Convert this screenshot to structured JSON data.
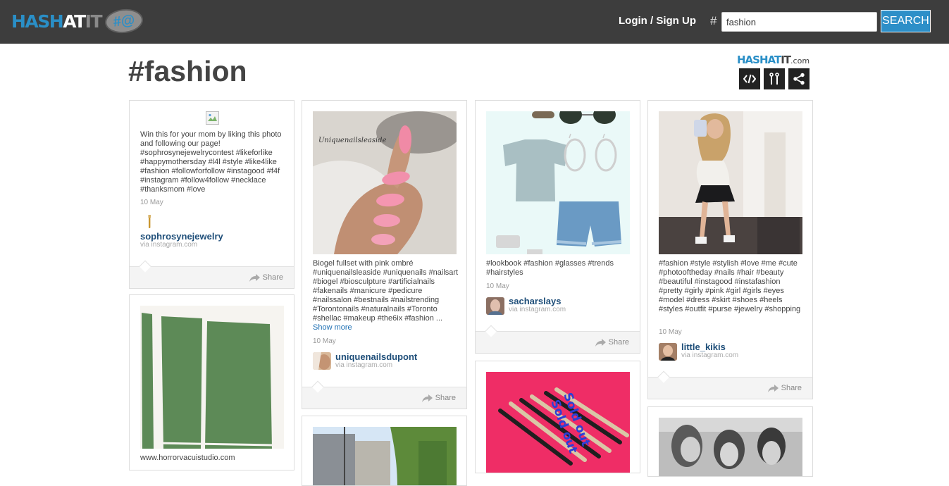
{
  "header": {
    "logo": {
      "hash": "HASH",
      "at": "AT",
      "it": "IT",
      "bubble": "#@"
    },
    "login_label": "Login / Sign Up",
    "hash_symbol": "#",
    "search_value": "fashion",
    "search_button": "SEARCH"
  },
  "page": {
    "title": "#fashion"
  },
  "brand": {
    "hash": "HASH",
    "at": "AT",
    "it": "IT",
    "dotcom": ".com"
  },
  "toolbar": [
    {
      "icon": "embed-code-icon"
    },
    {
      "icon": "customize-icon"
    },
    {
      "icon": "share-icon"
    }
  ],
  "colors": {
    "accent": "#2d8fc8",
    "topbar": "#3d3d3d",
    "username": "#1e4e79"
  },
  "share_label": "Share",
  "via_label": "via instagram.com",
  "posts": [
    {
      "caption": "Win this for your mom by liking this photo and following our page! #sophrosynejewelrycontest #likeforlike #happymothersday #l4l #style #like4like #fashion #followforfollow #instagood #f4f #instagram #follow4follow #necklace #thanksmom #love",
      "date": "10 May",
      "user": "sophrosynejewelry"
    },
    {
      "caption": "Biogel fullset with pink ombré #uniquenailsleaside #uniquenails #nailsart #biogel #biosculpture #artificialnails #fakenails #manicure #pedicure #nailssalon #bestnails #nailstrending #Torontonails #naturalnails #Toronto #shellac #makeup #the6ix #fashion ...",
      "show_more": "Show more",
      "image_text": "Uniquenailsleaside",
      "date": "10 May",
      "user": "uniquenailsdupont"
    },
    {
      "caption": "#lookbook #fashion #glasses #trends #hairstyles",
      "date": "10 May",
      "user": "sacharslays"
    },
    {
      "caption": "#fashion #style #stylish #love #me #cute #photooftheday #nails #hair #beauty #beautiful #instagood #instafashion #pretty #girly #pink #girl #girls #eyes #model #dress #skirt #shoes #heels #styles #outfit #purse #jewelry #shopping",
      "date": "10 May",
      "user": "little_kikis"
    },
    {
      "caption": "www.horrorvacuistudio.com"
    },
    {
      "image_text": "Sold out"
    }
  ]
}
